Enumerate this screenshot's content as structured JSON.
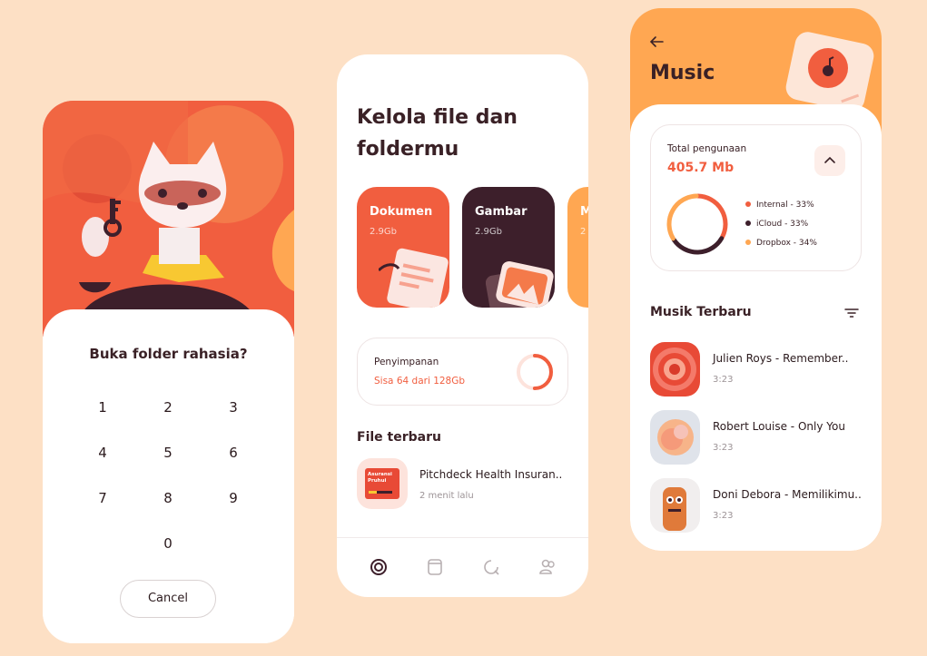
{
  "unlock_screen": {
    "question": "Buka folder rahasia?",
    "keypad": [
      "1",
      "2",
      "3",
      "4",
      "5",
      "6",
      "7",
      "8",
      "9",
      "0"
    ],
    "cancel_label": "Cancel"
  },
  "files_screen": {
    "title": "Kelola file dan foldermu",
    "categories": [
      {
        "label": "Dokumen",
        "size": "2.9Gb",
        "color": "#f15e3f"
      },
      {
        "label": "Gambar",
        "size": "2.9Gb",
        "color": "#3d1f2b"
      },
      {
        "label": "M",
        "size": "2",
        "color": "#ffa752"
      }
    ],
    "storage": {
      "title": "Penyimpanan",
      "subtitle": "Sisa 64 dari 128Gb",
      "used_fraction": 0.5
    },
    "recent_section": "File terbaru",
    "recent_files": [
      {
        "name": "Pitchdeck Health Insuran..",
        "time": "2 menit lalu",
        "thumb_text": "Asuransi Pruhui"
      }
    ],
    "bottom_nav": [
      "storage-ring-icon",
      "document-icon",
      "recent-icon",
      "users-icon"
    ]
  },
  "music_screen": {
    "title": "Music",
    "usage": {
      "label": "Total pengunaan",
      "value": "405.7 Mb"
    },
    "chart_data": {
      "type": "pie",
      "categories": [
        "Internal",
        "iCloud",
        "Dropbox"
      ],
      "values": [
        33,
        33,
        34
      ],
      "labels": [
        "Internal - 33%",
        "iCloud - 33%",
        "Dropbox - 34%"
      ],
      "colors": [
        "#f15e3f",
        "#3d1f2b",
        "#ffa752"
      ],
      "legend_position": "right"
    },
    "section": "Musik Terbaru",
    "songs": [
      {
        "title": "Julien Roys - Remember..",
        "duration": "3:23"
      },
      {
        "title": "Robert Louise - Only You",
        "duration": "3:23"
      },
      {
        "title": "Doni Debora - Memilikimu..",
        "duration": "3:23"
      }
    ]
  },
  "colors": {
    "background": "#fde0c5",
    "accent_red": "#f15e3f",
    "accent_orange": "#ffa752",
    "dark": "#3d1f2b"
  }
}
